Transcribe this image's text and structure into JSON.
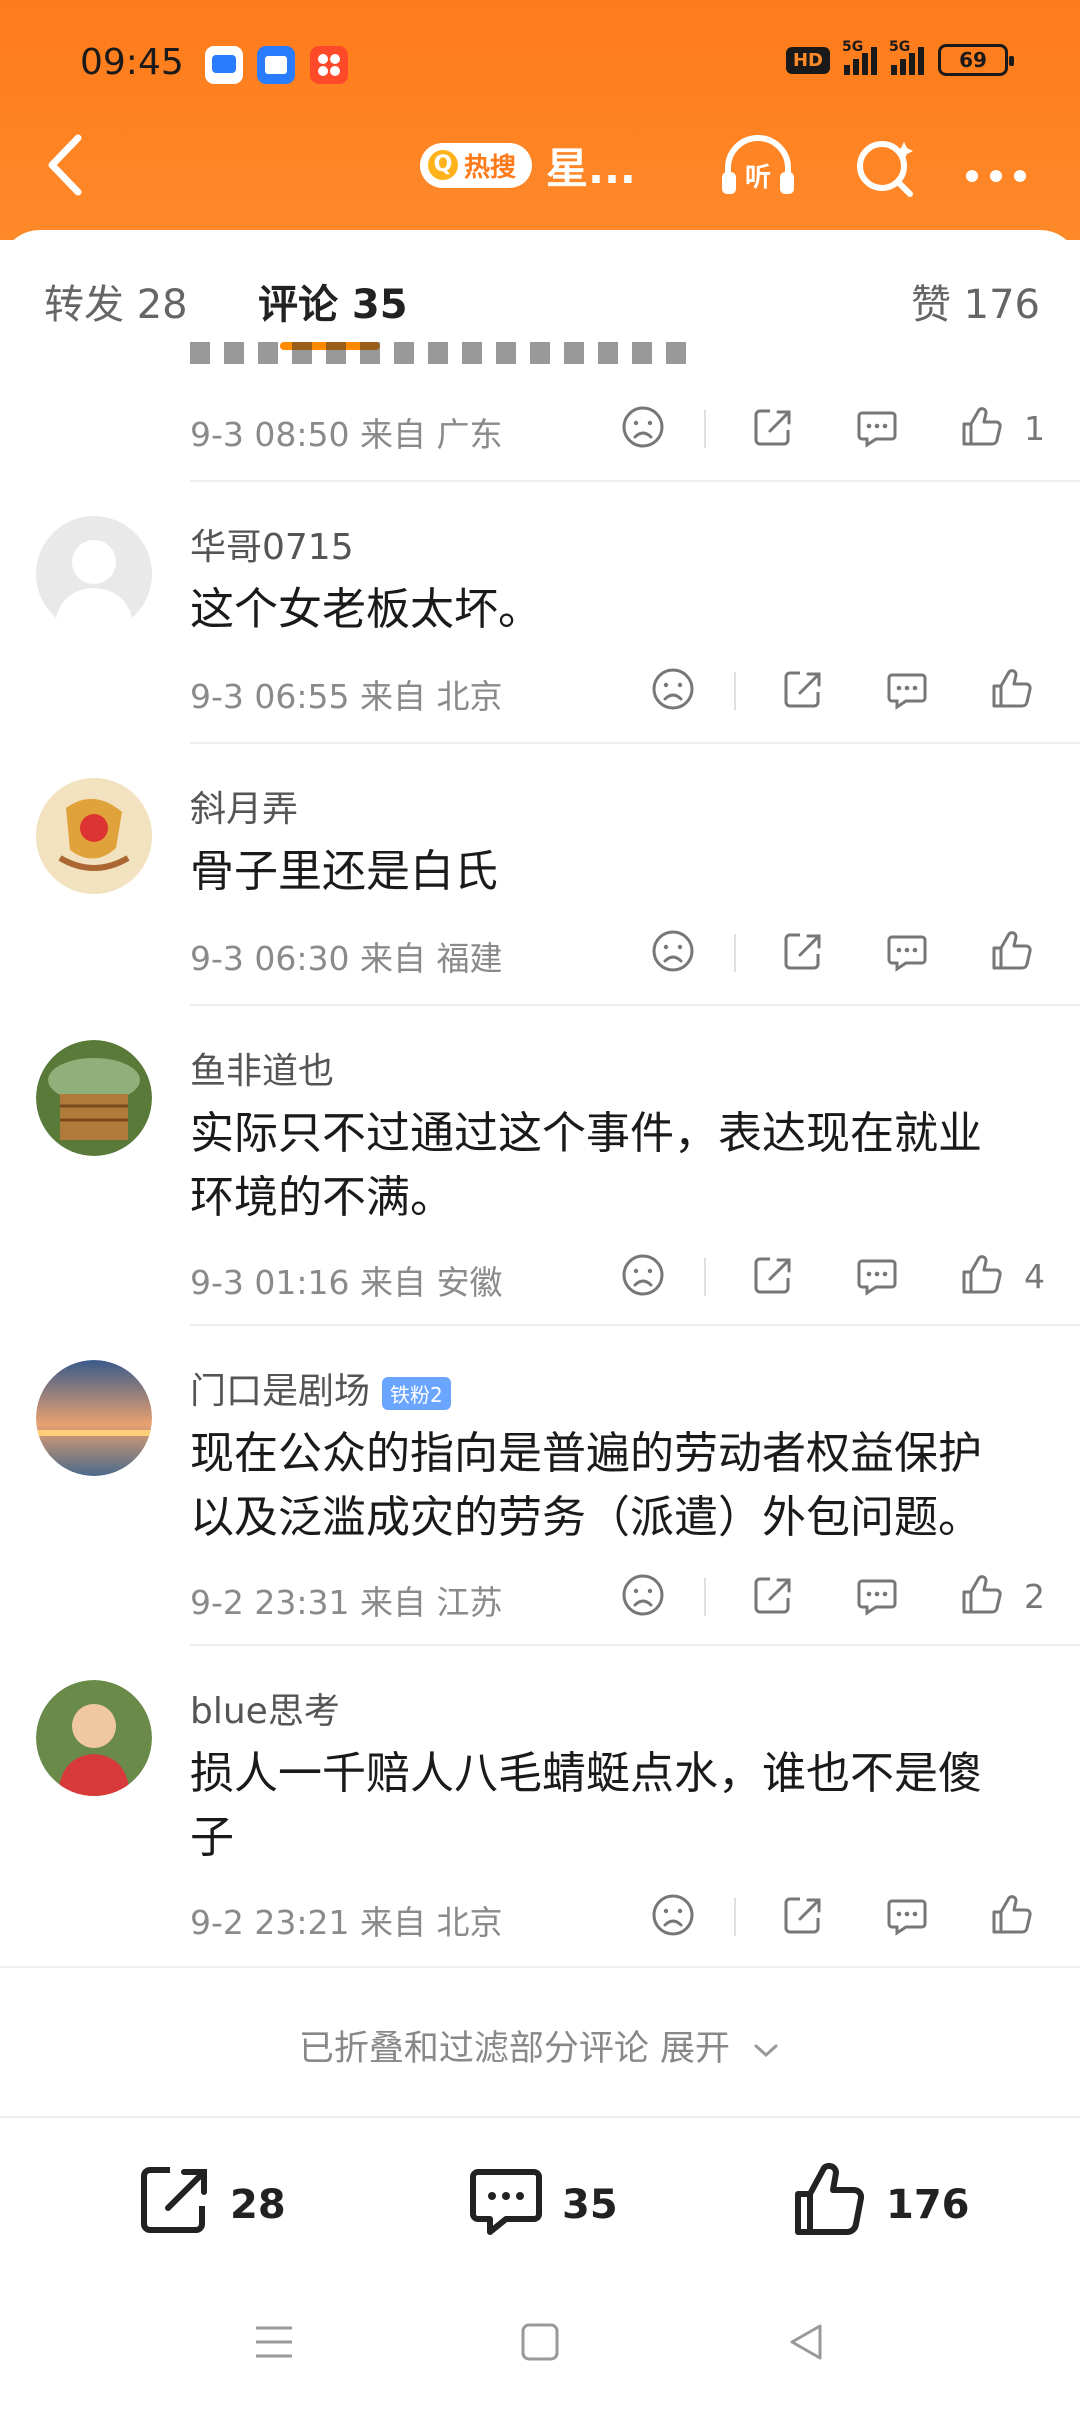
{
  "status_bar": {
    "time": "09:45",
    "network1": "5G",
    "network2": "5G",
    "battery": "69",
    "hd": "HD"
  },
  "nav": {
    "hot_label": "热搜",
    "title": "星...",
    "listen_label": "听"
  },
  "tabs": {
    "repost": "转发 28",
    "comments": "评论 35",
    "likes": "赞 176"
  },
  "partial_comment": {
    "meta": "9-3 08:50  来自 广东",
    "likes": "1"
  },
  "comments": [
    {
      "user": "华哥0715",
      "text": "这个女老板太坏。",
      "meta": "9-3 06:55  来自 北京",
      "likes": ""
    },
    {
      "user": "斜月弄",
      "text": "骨子里还是白氏",
      "meta": "9-3 06:30  来自 福建",
      "likes": ""
    },
    {
      "user": "鱼非道也",
      "text": "实际只不过通过这个事件，表达现在就业\n环境的不满。",
      "meta": "9-3 01:16  来自 安徽",
      "likes": "4"
    },
    {
      "user": "门口是剧场",
      "badge": "铁粉2",
      "text": "现在公众的指向是普遍的劳动者权益保护\n以及泛滥成灾的劳务（派遣）外包问题。",
      "meta": "9-2 23:31  来自 江苏",
      "likes": "2"
    },
    {
      "user": "blue思考",
      "text": "损人一千赔人八毛蜻蜓点水，谁也不是傻\n子",
      "meta": "9-2 23:21  来自 北京",
      "likes": ""
    }
  ],
  "collapsed_notice": "已折叠和过滤部分评论 展开",
  "bottom_bar": {
    "reposts": "28",
    "comments": "35",
    "likes": "176"
  },
  "colors": {
    "header": "#ff7a1a",
    "accent": "#ff8a00"
  }
}
